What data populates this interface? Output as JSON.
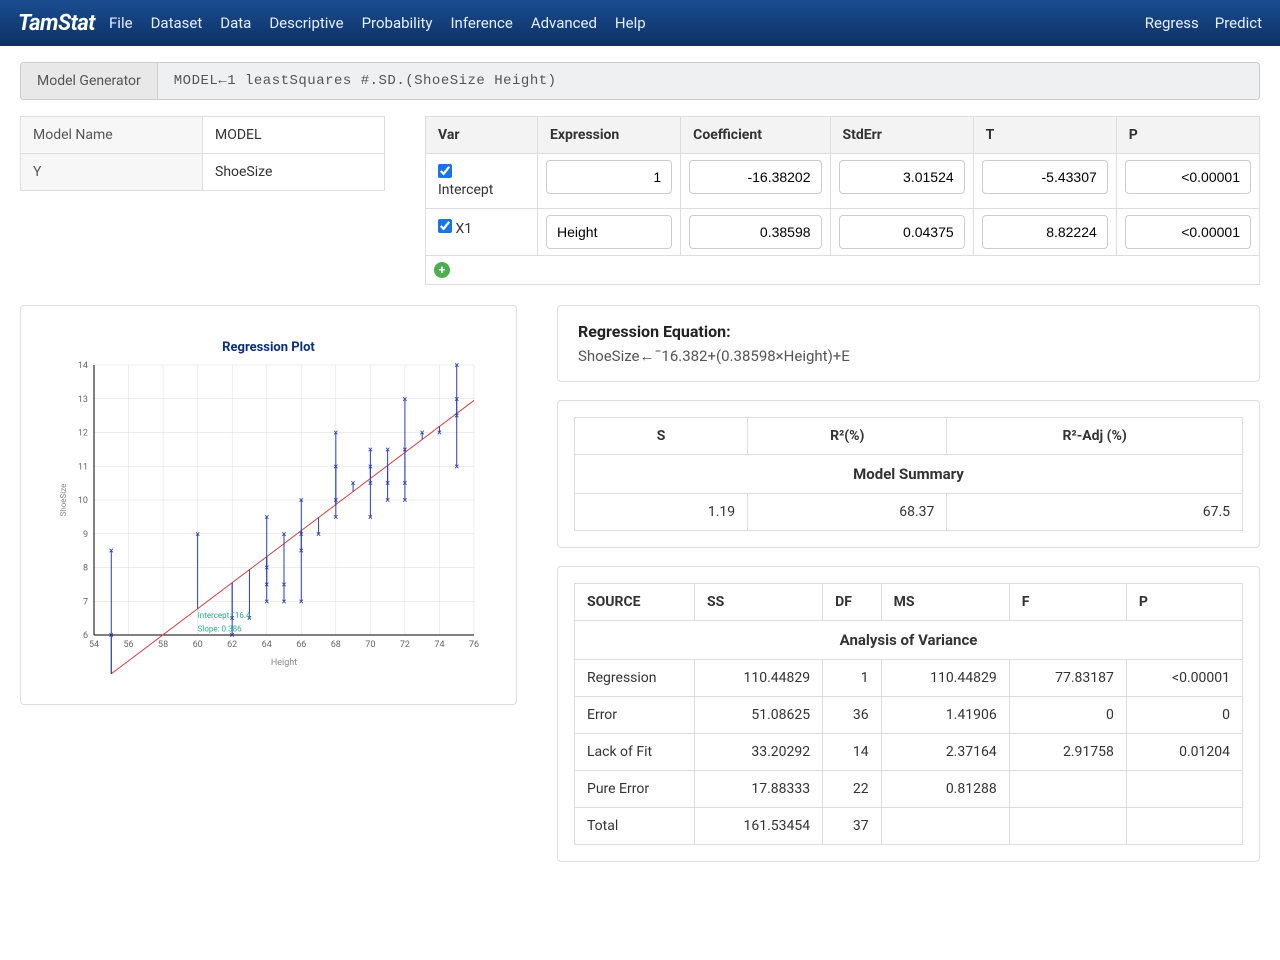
{
  "brand": "TamStat",
  "menu": [
    "File",
    "Dataset",
    "Data",
    "Descriptive",
    "Probability",
    "Inference",
    "Advanced",
    "Help"
  ],
  "right_menu": [
    "Regress",
    "Predict"
  ],
  "cmdbar": {
    "label": "Model Generator",
    "cmd": "MODEL←1 leastSquares #.SD.(ShoeSize Height)"
  },
  "props": {
    "model_name_label": "Model Name",
    "model_name_value": "MODEL",
    "y_label": "Y",
    "y_value": "ShoeSize"
  },
  "coef": {
    "headers": [
      "Var",
      "Expression",
      "Coefficient",
      "StdErr",
      "T",
      "P"
    ],
    "rows": [
      {
        "var": "Intercept",
        "checked": true,
        "expr": "1",
        "coef": "-16.38202",
        "se": "3.01524",
        "t": "-5.43307",
        "p": "<0.00001"
      },
      {
        "var": "X1",
        "checked": true,
        "expr": "Height",
        "coef": "0.38598",
        "se": "0.04375",
        "t": "8.82224",
        "p": "<0.00001"
      }
    ]
  },
  "equation": {
    "title": "Regression Equation:",
    "text": "ShoeSize←¯16.382+(0.38598×Height)+E"
  },
  "summary": {
    "title": "Model Summary",
    "headers": [
      "S",
      "R²(%)",
      "R²-Adj (%)"
    ],
    "values": [
      "1.19",
      "68.37",
      "67.5"
    ]
  },
  "anova": {
    "title": "Analysis of Variance",
    "headers": [
      "SOURCE",
      "SS",
      "DF",
      "MS",
      "F",
      "P"
    ],
    "rows": [
      [
        "Regression",
        "110.44829",
        "1",
        "110.44829",
        "77.83187",
        "<0.00001"
      ],
      [
        "Error",
        "51.08625",
        "36",
        "1.41906",
        "0",
        "0"
      ],
      [
        "Lack of Fit",
        "33.20292",
        "14",
        "2.37164",
        "2.91758",
        "0.01204"
      ],
      [
        "Pure Error",
        "17.88333",
        "22",
        "0.81288",
        "",
        ""
      ],
      [
        "Total",
        "161.53454",
        "37",
        "",
        "",
        ""
      ]
    ]
  },
  "chart_data": {
    "type": "scatter",
    "title": "Regression Plot",
    "xlabel": "Height",
    "ylabel": "ShoeSize",
    "xlim": [
      54,
      76
    ],
    "ylim": [
      6,
      14
    ],
    "annotations": [
      "Intercept:¯16.4",
      "Slope: 0.386"
    ],
    "regression_line": {
      "x1": 55,
      "y1": 4.85,
      "x2": 76,
      "y2": 12.95
    },
    "points": [
      {
        "x": 55,
        "y": 6
      },
      {
        "x": 55,
        "y": 8.5
      },
      {
        "x": 60,
        "y": 9
      },
      {
        "x": 62,
        "y": 6
      },
      {
        "x": 62,
        "y": 6.5
      },
      {
        "x": 63,
        "y": 6.5
      },
      {
        "x": 64,
        "y": 7
      },
      {
        "x": 64,
        "y": 7.5
      },
      {
        "x": 64,
        "y": 8
      },
      {
        "x": 64,
        "y": 9.5
      },
      {
        "x": 65,
        "y": 7
      },
      {
        "x": 65,
        "y": 7.5
      },
      {
        "x": 65,
        "y": 9
      },
      {
        "x": 66,
        "y": 7
      },
      {
        "x": 66,
        "y": 8.5
      },
      {
        "x": 66,
        "y": 9
      },
      {
        "x": 66,
        "y": 10
      },
      {
        "x": 67,
        "y": 9
      },
      {
        "x": 68,
        "y": 9.5
      },
      {
        "x": 68,
        "y": 10
      },
      {
        "x": 68,
        "y": 11
      },
      {
        "x": 68,
        "y": 12
      },
      {
        "x": 69,
        "y": 10.5
      },
      {
        "x": 70,
        "y": 9.5
      },
      {
        "x": 70,
        "y": 10.5
      },
      {
        "x": 70,
        "y": 11
      },
      {
        "x": 70,
        "y": 11.5
      },
      {
        "x": 71,
        "y": 10
      },
      {
        "x": 71,
        "y": 10.5
      },
      {
        "x": 71,
        "y": 11.5
      },
      {
        "x": 72,
        "y": 10
      },
      {
        "x": 72,
        "y": 10.5
      },
      {
        "x": 72,
        "y": 11.5
      },
      {
        "x": 72,
        "y": 13
      },
      {
        "x": 73,
        "y": 12
      },
      {
        "x": 74,
        "y": 12
      },
      {
        "x": 75,
        "y": 11
      },
      {
        "x": 75,
        "y": 12.5
      },
      {
        "x": 75,
        "y": 13
      },
      {
        "x": 75,
        "y": 14
      }
    ]
  }
}
